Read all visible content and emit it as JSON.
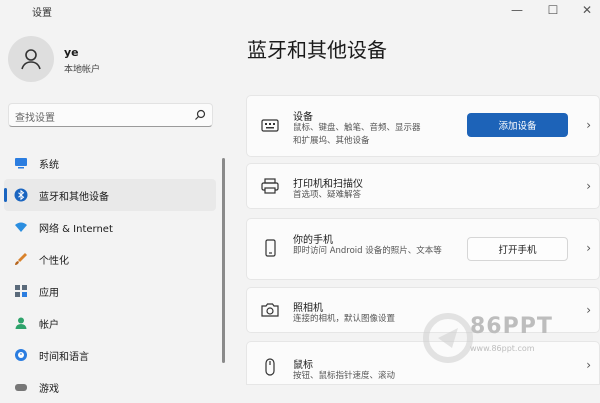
{
  "window": {
    "title": "设置",
    "minimize": "—",
    "maximize": "☐",
    "close": "✕"
  },
  "profile": {
    "name": "ye",
    "account_type": "本地帐户"
  },
  "search": {
    "placeholder": "查找设置"
  },
  "sidebar": {
    "items": [
      {
        "label": "系统",
        "icon": "monitor-icon",
        "color": "#2b7de0"
      },
      {
        "label": "蓝牙和其他设备",
        "icon": "bluetooth-icon",
        "color": "#1a65c0",
        "active": true
      },
      {
        "label": "网络 & Internet",
        "icon": "wifi-icon",
        "color": "#2b8ee0"
      },
      {
        "label": "个性化",
        "icon": "brush-icon",
        "color": "#d9822b"
      },
      {
        "label": "应用",
        "icon": "apps-icon",
        "color": "#5a6a7a"
      },
      {
        "label": "帐户",
        "icon": "person-icon",
        "color": "#2ea36b"
      },
      {
        "label": "时间和语言",
        "icon": "globe-clock-icon",
        "color": "#2b7de0"
      },
      {
        "label": "游戏",
        "icon": "gamepad-icon",
        "color": "#777777"
      }
    ]
  },
  "main": {
    "title": "蓝牙和其他设备",
    "cards": [
      {
        "title": "设备",
        "desc": "鼠标、键盘、触笔、音频、显示器和扩展坞、其他设备",
        "button": "添加设备",
        "icon": "keyboard-icon"
      },
      {
        "title": "打印机和扫描仪",
        "desc": "首选项、疑难解答",
        "icon": "printer-icon"
      },
      {
        "title": "你的手机",
        "desc": "即时访问 Android 设备的照片、文本等",
        "button": "打开手机",
        "icon": "phone-icon"
      },
      {
        "title": "照相机",
        "desc": "连接的相机，默认图像设置",
        "icon": "camera-icon"
      },
      {
        "title": "鼠标",
        "desc": "按钮、鼠标指针速度、滚动",
        "icon": "mouse-icon"
      }
    ]
  },
  "watermark": {
    "text": "86PPT",
    "url": "www.86ppt.com"
  },
  "colors": {
    "accent": "#1d63b8",
    "background": "#f3f3f3",
    "card": "#fbfbfb"
  }
}
